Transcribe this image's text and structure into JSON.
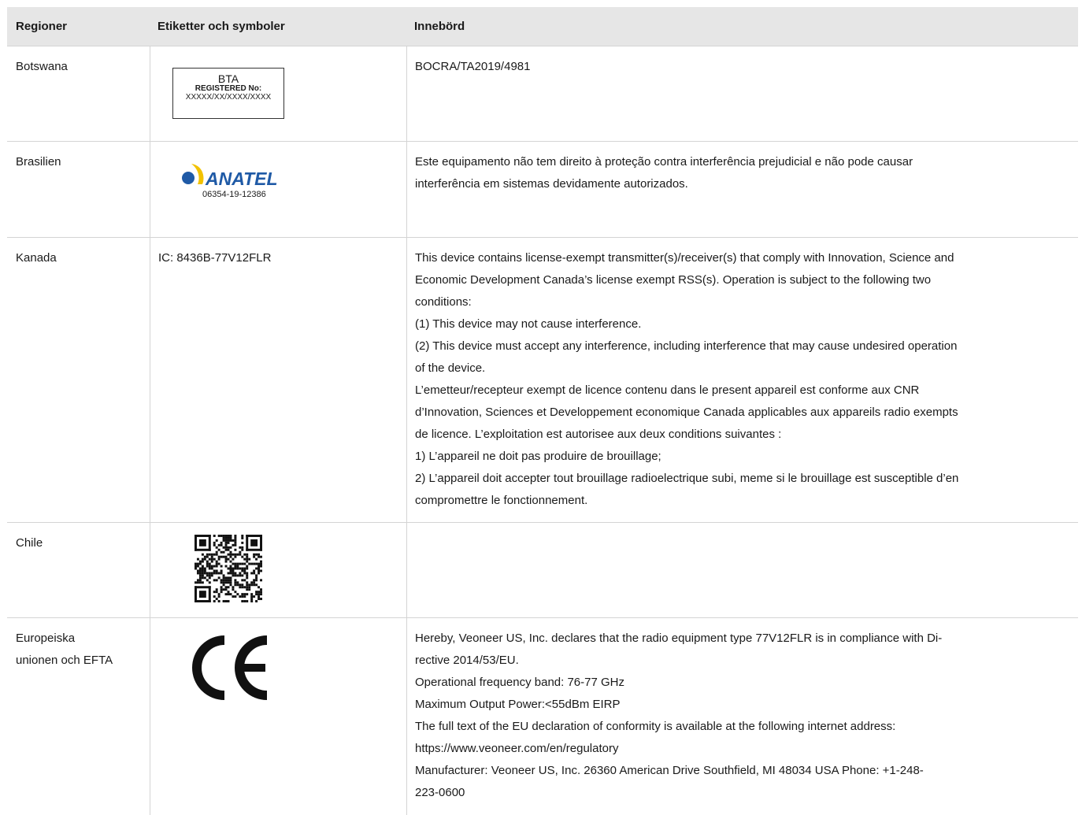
{
  "header": {
    "col1": "Regioner",
    "col2": "Etiketter och symboler",
    "col3": "Innebörd"
  },
  "rows": {
    "botswana": {
      "region": "Botswana",
      "label_title": "BTA",
      "label_reg": "REGISTERED No:",
      "label_num": "XXXXX/XX/XXXX/XXXX",
      "meaning": "BOCRA/TA2019/4981"
    },
    "brasilien": {
      "region": "Brasilien",
      "logo_text": "ANATEL",
      "logo_code": "06354-19-12386",
      "meaning": [
        "Este equipamento não tem direito à proteção contra interferência prejudicial e não pode causar",
        "interferência em sistemas devidamente autorizados."
      ]
    },
    "kanada": {
      "region": "Kanada",
      "label": "IC: 8436B-77V12FLR",
      "meaning": [
        "This device contains license-exempt transmitter(s)/receiver(s) that comply with Innovation, Science and",
        "Economic Development Canada’s license exempt RSS(s). Operation is subject to the following two",
        "conditions:",
        "(1) This device may not cause interference.",
        "(2) This device must accept any interference, including interference that may cause undesired operation",
        "of the device.",
        "L’emetteur/recepteur exempt de licence contenu dans le present appareil est conforme aux CNR",
        "d’Innovation, Sciences et Developpement economique Canada applicables aux appareils radio exempts",
        "de licence. L’exploitation est autorisee aux deux conditions suivantes :",
        "1) L’appareil ne doit pas produire de brouillage;",
        "2) L’appareil doit accepter tout brouillage radioelectrique subi, meme si le brouillage est susceptible d’en",
        "compromettre le fonctionnement."
      ]
    },
    "chile": {
      "region": "Chile"
    },
    "eu": {
      "region_line1": "Europeiska",
      "region_line2": "unionen och EFTA",
      "meaning": [
        "Hereby, Veoneer US, Inc. declares that the radio equipment type 77V12FLR is in compliance with Di-",
        "rective 2014/53/EU.",
        "Operational frequency band: 76-77 GHz",
        "Maximum Output Power:<55dBm EIRP",
        "The full text of the EU declaration of conformity is available at the following internet address:",
        "https://www.veoneer.com/en/regulatory",
        "Manufacturer: Veoneer US, Inc. 26360 American Drive Southfield, MI 48034 USA Phone: +1-248-",
        "223-0600"
      ]
    }
  },
  "colors": {
    "header_bg": "#e6e6e6",
    "border": "#d4d4d4",
    "anatel_blue": "#1f5aa6",
    "anatel_yellow": "#f2c200"
  }
}
